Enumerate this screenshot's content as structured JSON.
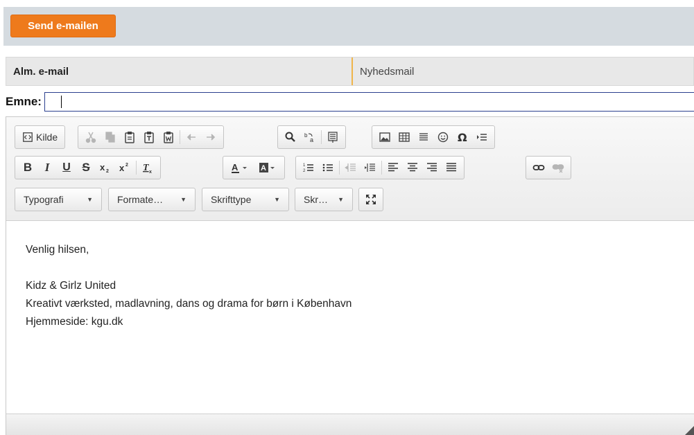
{
  "send_label": "Send e-mailen",
  "tabs": [
    {
      "label": "Alm. e-mail"
    },
    {
      "label": "Nyhedsmail"
    }
  ],
  "subject": {
    "label": "Emne:",
    "value": ""
  },
  "toolbar": {
    "source_label": "Kilde",
    "combos": {
      "styles": "Typografi",
      "format": "Formate…",
      "font": "Skrifttype",
      "size": "Skr…"
    }
  },
  "body": {
    "greeting": "Venlig hilsen,",
    "org": "Kidz & Girlz United",
    "tagline": "Kreativt værksted, madlavning, dans og drama for børn i København",
    "website": "Hjemmeside: kgu.dk"
  }
}
